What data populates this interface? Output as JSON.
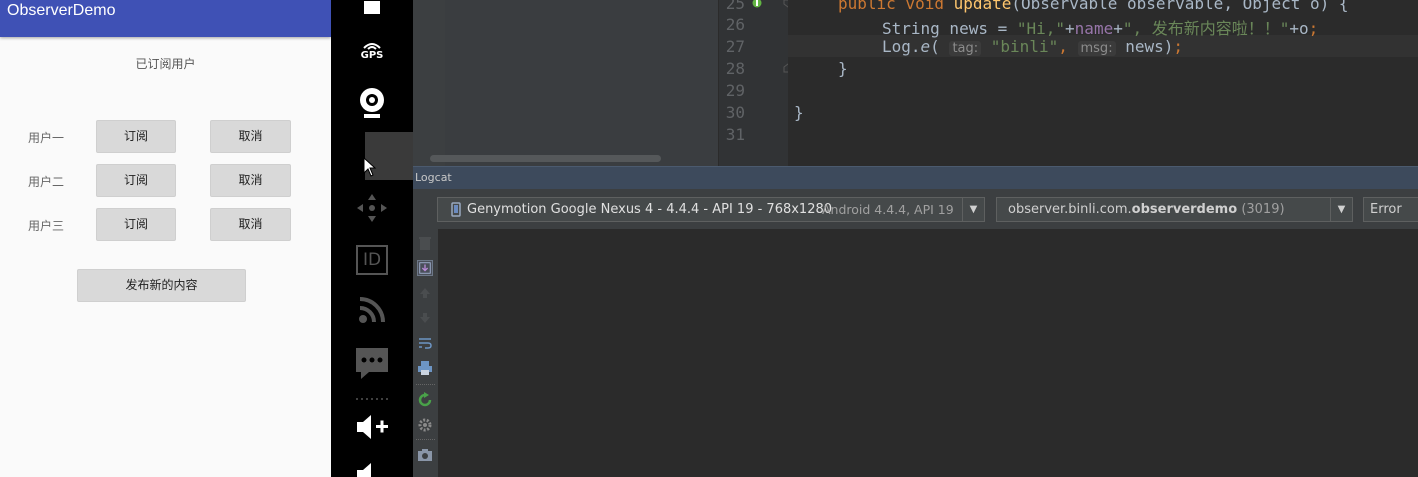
{
  "app": {
    "title": "ObserverDemo",
    "subscribed_label": "已订阅用户",
    "users": [
      {
        "label": "用户一",
        "subscribe": "订阅",
        "cancel": "取消"
      },
      {
        "label": "用户二",
        "subscribe": "订阅",
        "cancel": "取消"
      },
      {
        "label": "用户三",
        "subscribe": "订阅",
        "cancel": "取消"
      }
    ],
    "publish_label": "发布新的内容"
  },
  "emulator_toolbar": {
    "gps_label": "GPS",
    "id_label": "ID",
    "icons": [
      "power-icon",
      "gps-icon",
      "webcam-icon",
      "dpad-icon",
      "id-icon",
      "rss-icon",
      "sms-icon",
      "volume-up-icon",
      "volume-down-icon"
    ]
  },
  "editor": {
    "lines": [
      {
        "num": "25",
        "text": "public void update(Observable observable, Object o) {"
      },
      {
        "num": "26",
        "text": "String news = \"Hi,\"+name+\", 发布新内容啦！！\"+o;"
      },
      {
        "num": "27",
        "text": "Log.e( tag: \"binli\", msg: news);"
      },
      {
        "num": "28",
        "text": "}"
      },
      {
        "num": "29",
        "text": ""
      },
      {
        "num": "30",
        "text": "}"
      },
      {
        "num": "31",
        "text": ""
      }
    ]
  },
  "logcat": {
    "title": "Logcat",
    "device": "Genymotion Google Nexus 4 - 4.4.4 - API 19 - 768x1280",
    "device_detail": "Android 4.4.4, API 19",
    "process_prefix": "observer.binli.com.",
    "process_bold": "observerdemo",
    "process_pid": "(3019)",
    "level": "Error"
  },
  "colors": {
    "app_bar": "#3f51b5",
    "keyword": "#cc7832",
    "string": "#6a8759",
    "function": "#ffc66d",
    "field": "#9876aa"
  }
}
